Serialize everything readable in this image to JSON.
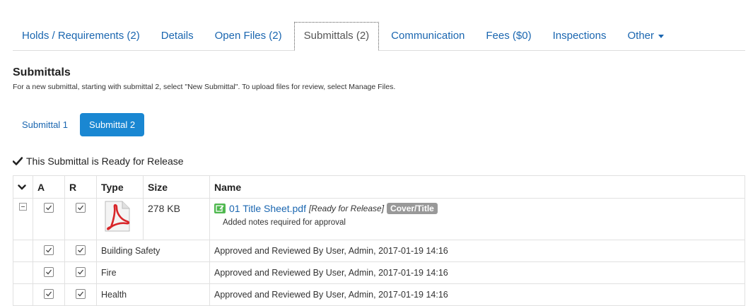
{
  "tabs": [
    {
      "label": "Holds / Requirements (2)",
      "active": false
    },
    {
      "label": "Details",
      "active": false
    },
    {
      "label": "Open Files (2)",
      "active": false
    },
    {
      "label": "Submittals (2)",
      "active": true
    },
    {
      "label": "Communication",
      "active": false
    },
    {
      "label": "Fees ($0)",
      "active": false
    },
    {
      "label": "Inspections",
      "active": false
    },
    {
      "label": "Other",
      "active": false
    }
  ],
  "section": {
    "title": "Submittals",
    "description": "For a new submittal, starting with submittal 2, select \"New Submittal\". To upload files for review, select Manage Files."
  },
  "submittal_tabs": [
    {
      "label": "Submittal 1",
      "active": false
    },
    {
      "label": "Submittal 2",
      "active": true
    }
  ],
  "ready_message": "This Submittal is Ready for Release",
  "table": {
    "headers": {
      "toggle_icon": "chevron-down-icon",
      "a": "A",
      "r": "R",
      "type": "Type",
      "size": "Size",
      "name": "Name"
    },
    "file": {
      "size": "278 KB",
      "name": "01 Title Sheet.pdf",
      "status": "[Ready for Release]",
      "badge": "Cover/Title",
      "notes": "Added notes required for approval",
      "a_checked": true,
      "r_checked": true,
      "type_icon": "pdf-icon"
    },
    "reviews": [
      {
        "department": "Building Safety",
        "result": "Approved and Reviewed By User, Admin, 2017-01-19 14:16"
      },
      {
        "department": "Fire",
        "result": "Approved and Reviewed By User, Admin, 2017-01-19 14:16"
      },
      {
        "department": "Health",
        "result": "Approved and Reviewed By User, Admin, 2017-01-19 14:16"
      }
    ]
  },
  "colors": {
    "link": "#1a66b0",
    "active_pill": "#1a87d2",
    "badge": "#999999",
    "file_icon": "#4fb84f"
  }
}
